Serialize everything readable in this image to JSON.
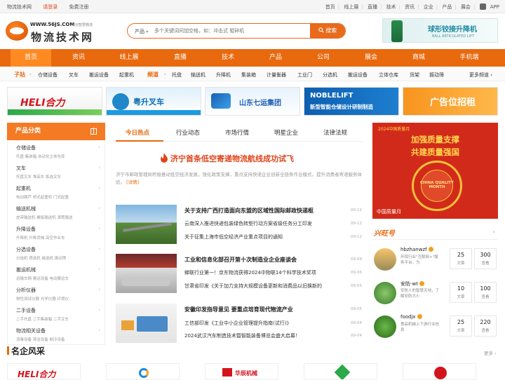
{
  "topbar": {
    "site_name": "物流技术网",
    "login": "请登录",
    "register": "免费注册",
    "links": [
      "首页",
      "线上展",
      "直播",
      "技术",
      "资讯",
      "企业",
      "产品",
      "展会"
    ],
    "app": "APP"
  },
  "header": {
    "logo_url": "WWW.56JS.COM",
    "logo_slogan": "共创智慧物流",
    "logo_name": "物流技术网",
    "search_category": "产品",
    "search_placeholder": "多个关键词间加空格，如：冲击式 辊碎机",
    "search_button": "搜索",
    "ad_title": "球形铰接升降机",
    "ad_subtitle": "BALL ARTICULATED LIFT"
  },
  "main_nav": [
    "首页",
    "资讯",
    "线上展",
    "直播",
    "技术",
    "产品",
    "公司",
    "展会",
    "商城",
    "手机端"
  ],
  "sub_nav": {
    "zhan_label": "子站",
    "zhan_items": [
      "仓储设备",
      "叉车",
      "搬运设备",
      "起重机"
    ],
    "pindao_label": "频道",
    "pindao_items": [
      "托盘",
      "输送机",
      "升降机",
      "集装箱",
      "计量衡器",
      "工业门",
      "分选机",
      "搬运设备",
      "立体仓库",
      "货架",
      "振动筛"
    ],
    "more": "更多频道"
  },
  "banner_ads": [
    {
      "name": "heli",
      "text": "HELI合力"
    },
    {
      "name": "yuesheng",
      "text": "粤升叉车"
    },
    {
      "name": "shandong",
      "text": "山东七运集团"
    },
    {
      "name": "noblelift",
      "text": "NOBLELIFT",
      "sub": "新型智能仓储设计研制制造"
    },
    {
      "name": "ad-recruit",
      "text": "广告位招租"
    }
  ],
  "categories": {
    "title": "产品分类",
    "items": [
      {
        "name": "仓储设备",
        "subs": "托盘 集装箱 自动化立体仓库"
      },
      {
        "name": "叉车",
        "subs": "托盘叉车 堆高车 拣选叉车"
      },
      {
        "name": "起重机",
        "subs": "电动葫芦 桥式起重机 门式起重"
      },
      {
        "name": "输送机械",
        "subs": "皮带输送机 螺旋输送机 滚筒输送"
      },
      {
        "name": "升降设备",
        "subs": "升降机 升降货梯 高空作业车"
      },
      {
        "name": "分选设备",
        "subs": "分选机 筛选机 磁选机 振动筛"
      },
      {
        "name": "搬运机械",
        "subs": "运输车辆 搬运设备 电动搬运车"
      },
      {
        "name": "分析仪器",
        "subs": "物性测试仪器 光学仪器 环境仪"
      },
      {
        "name": "二手设备",
        "subs": "二手托盘 二手集装箱 二手叉车"
      },
      {
        "name": "物流相关设备",
        "subs": "消毒设备 清洁设备 制冷设备"
      }
    ]
  },
  "tabs": [
    "今日热点",
    "行业动态",
    "市场行情",
    "明星企业",
    "法律法规"
  ],
  "headline": {
    "title": "济宁首条低空寄递物流航线成功试飞",
    "summary": "济宁市邮政管理局积极推动低空经济发展，强化政策支撑，重点支持快递企业创新全链条作业模式，提升消费者寄递服务体验。",
    "more": "[详情]"
  },
  "news": [
    {
      "title": "关于支持广西打造面向东盟的区域性国际邮政快递枢",
      "date": "09-12",
      "items": [
        {
          "text": "云南深入推进快递包装绿色转型行动方案省级任务分工印发",
          "date": "09-12"
        },
        {
          "text": "关于征集上海市低空经济产业重点项目的通知",
          "date": "09-12"
        }
      ]
    },
    {
      "title": "工业和信息化部召开第十次制造业企业座谈会",
      "date": "09-09",
      "items": [
        {
          "text": "蝉联行业第一！京东物流获得2024中物联14个科学技术奖项",
          "date": "09-06"
        },
        {
          "text": "甘肃省印发《关于加力支持大规模设备更新和消费品以旧换新的",
          "date": "09-05"
        }
      ]
    },
    {
      "title": "安徽印发指导意见 要重点培育现代物流产业",
      "date": "09-05",
      "items": [
        {
          "text": "工信部印发《工业中小企业管理提升指南(试行)》",
          "date": "09-04"
        },
        {
          "text": "2024武汉汽车制造技术暨智能装备博览会盛大启幕！",
          "date": "09-04"
        }
      ]
    }
  ],
  "quality": {
    "top": "2024中国质量月",
    "line1": "加强质量支撑",
    "line2": "共建质量强国",
    "seal": "CHINA QUALITY MONTH",
    "caption": "中国质量月"
  },
  "xingwang": {
    "title": "兴旺号",
    "users": [
      {
        "name": "hbzhanwzf",
        "desc": "环保行业\"互联网+\"服务平台，为",
        "articles": "25",
        "views": "300"
      },
      {
        "name": "安防-wt",
        "desc": "安防人的智慧天地，了解安防大小",
        "articles": "10",
        "views": "100"
      },
      {
        "name": "foodjx",
        "desc": "食品机械上下游行业信息",
        "articles": "25",
        "views": "220"
      }
    ],
    "article_label": "文章",
    "view_label": "查看"
  },
  "enterprises": {
    "title": "名企风采",
    "more": "更多",
    "logos": [
      "HELI合力",
      "",
      "华辰机械",
      "",
      ""
    ]
  },
  "colors": {
    "brand": "#e8690e",
    "nav_active": "#ff8a22",
    "headline": "#e0441a"
  }
}
